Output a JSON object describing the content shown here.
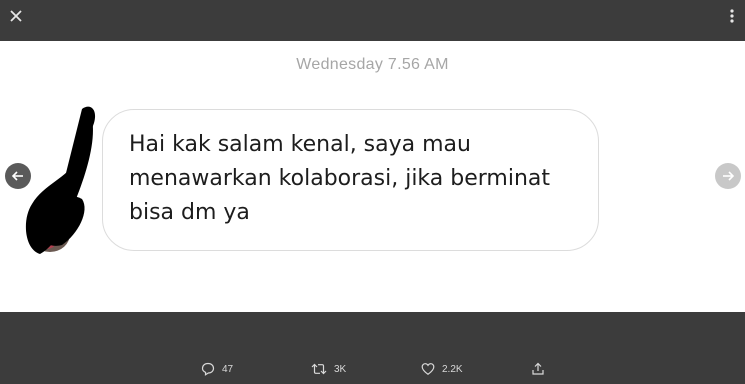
{
  "viewer": {
    "close_icon": "close-icon",
    "more_icon": "more-vertical-icon"
  },
  "message": {
    "timestamp": "Wednesday 7.56 AM",
    "text_lines": [
      "Hai kak salam kenal, saya mau",
      "menawarkan kolaborasi, jika berminat",
      "bisa dm ya"
    ]
  },
  "navigation": {
    "prev_icon": "arrow-left-icon",
    "next_icon": "arrow-right-icon"
  },
  "actions": {
    "reply_count": "47",
    "retweet_count": "3K",
    "like_count": "2.2K",
    "share_icon": "share-icon"
  },
  "colors": {
    "chrome_background": "#3c3c3c",
    "photo_background": "#ffffff",
    "bubble_border": "#dcdcdc",
    "timestamp_text": "#a6a6a6"
  }
}
